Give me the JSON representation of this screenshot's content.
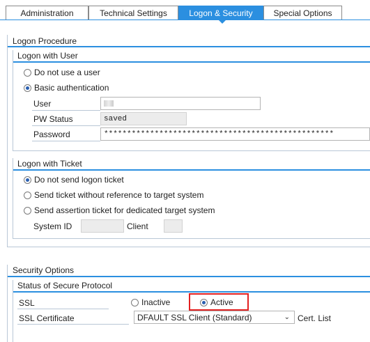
{
  "tabs": [
    {
      "label": "Administration"
    },
    {
      "label": "Technical Settings"
    },
    {
      "label": "Logon & Security"
    },
    {
      "label": "Special Options"
    }
  ],
  "logon_procedure": {
    "title": "Logon Procedure",
    "logon_with_user": {
      "title": "Logon with User",
      "options": [
        "Do not use a user",
        "Basic authentication"
      ],
      "selected": "Basic authentication",
      "user_label": "User",
      "user_value": "",
      "pw_status_label": "PW Status",
      "pw_status_value": "saved",
      "password_label": "Password",
      "password_value": "**************************************************"
    },
    "logon_with_ticket": {
      "title": "Logon with Ticket",
      "options": [
        "Do not send logon ticket",
        "Send ticket without reference to target system",
        "Send assertion ticket for dedicated target system"
      ],
      "selected": "Do not send logon ticket",
      "system_id_label": "System ID",
      "system_id_value": "",
      "client_label": "Client",
      "client_value": ""
    }
  },
  "security_options": {
    "title": "Security Options",
    "status_title": "Status of Secure Protocol",
    "ssl_label": "SSL",
    "ssl_inactive": "Inactive",
    "ssl_active": "Active",
    "ssl_selected": "Active",
    "ssl_certificate_label": "SSL Certificate",
    "ssl_certificate_value": "DFAULT SSL Client (Standard)",
    "cert_list_label": "Cert. List"
  },
  "colors": {
    "accent": "#2b8fe0",
    "highlight": "#e32020"
  }
}
